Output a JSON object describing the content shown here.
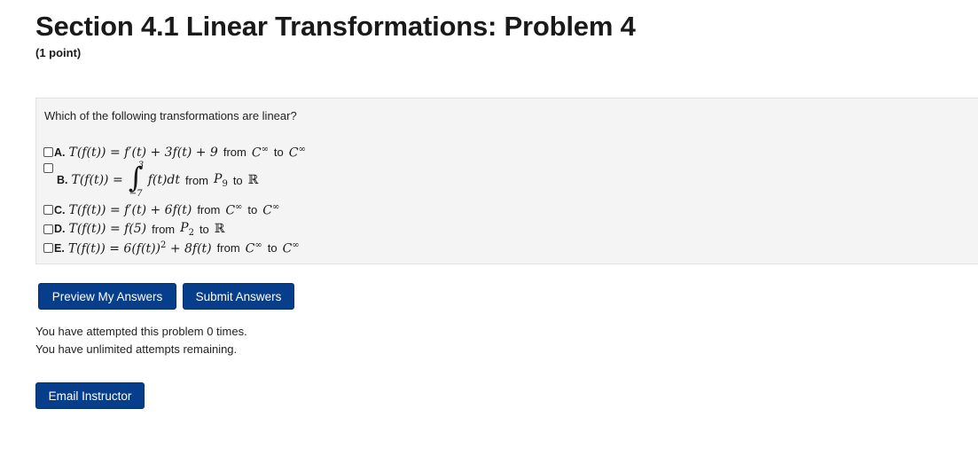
{
  "page": {
    "title": "Section 4.1 Linear Transformations: Problem 4",
    "points": "(1 point)"
  },
  "problem": {
    "question": "Which of the following transformations are linear?",
    "choices": [
      {
        "letter": "A.",
        "lhs": "T(f(t)) = f′(t) + 3f(t) + 9",
        "from_label": "from",
        "from_space": "C",
        "from_sup": "∞",
        "to_label": "to",
        "to_space": "C",
        "to_sup": "∞",
        "checked": false
      },
      {
        "letter": "B.",
        "lhs": "T(f(t)) =",
        "integral_upper": "3",
        "integral_lower": "−7",
        "integrand": "f(t)dt",
        "from_label": "from",
        "from_space": "P",
        "from_sub": "9",
        "to_label": "to",
        "to_space": "ℝ",
        "checked": false
      },
      {
        "letter": "C.",
        "lhs": "T(f(t)) = f′(t) + 6f(t)",
        "from_label": "from",
        "from_space": "C",
        "from_sup": "∞",
        "to_label": "to",
        "to_space": "C",
        "to_sup": "∞",
        "checked": false
      },
      {
        "letter": "D.",
        "lhs": "T(f(t)) = f(5)",
        "from_label": "from",
        "from_space": "P",
        "from_sub": "2",
        "to_label": "to",
        "to_space": "ℝ",
        "checked": false
      },
      {
        "letter": "E.",
        "lhs": "T(f(t)) = 6(f(t))",
        "lhs_sup": "2",
        "lhs_tail": "+ 8f(t)",
        "from_label": "from",
        "from_space": "C",
        "from_sup": "∞",
        "to_label": "to",
        "to_space": "C",
        "to_sup": "∞",
        "checked": false
      }
    ]
  },
  "buttons": {
    "preview": "Preview My Answers",
    "submit": "Submit Answers",
    "email": "Email Instructor"
  },
  "status": {
    "attempted": "You have attempted this problem 0 times.",
    "remaining": "You have unlimited attempts remaining."
  },
  "colors": {
    "button_bg": "#063e8c",
    "box_bg": "#f4f4f4"
  }
}
